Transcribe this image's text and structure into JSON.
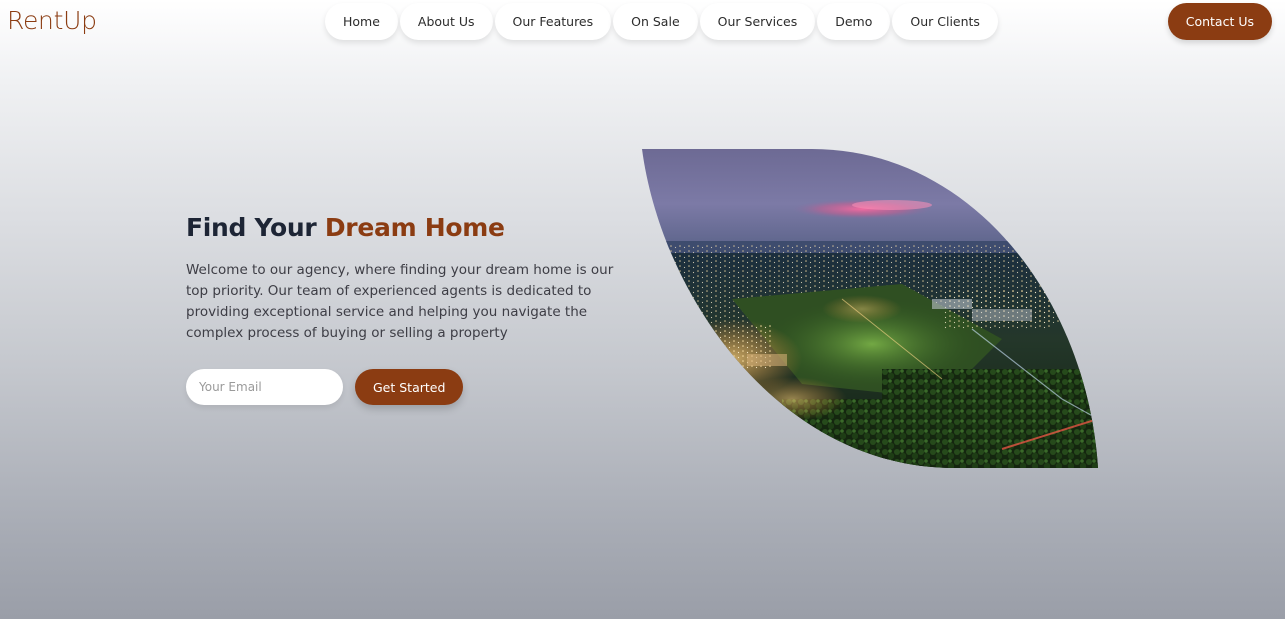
{
  "brand": {
    "logo": "RentUp",
    "accent_color": "#8b3c12",
    "heading_color": "#1d2535"
  },
  "nav": {
    "items": [
      {
        "label": "Home"
      },
      {
        "label": "About Us"
      },
      {
        "label": "Our Features"
      },
      {
        "label": "On Sale"
      },
      {
        "label": "Our Services"
      },
      {
        "label": "Demo"
      },
      {
        "label": "Our Clients"
      }
    ],
    "contact_label": "Contact Us"
  },
  "hero": {
    "title_prefix": "Find Your ",
    "title_accent": "Dream Home",
    "description": "Welcome to our agency, where finding your dream home is our top priority. Our team of experienced agents is dedicated to providing exceptional service and helping you navigate the complex process of buying or selling a property",
    "email_placeholder": "Your Email",
    "cta_label": "Get Started"
  },
  "image": {
    "subject": "aerial-night-city-photo"
  }
}
